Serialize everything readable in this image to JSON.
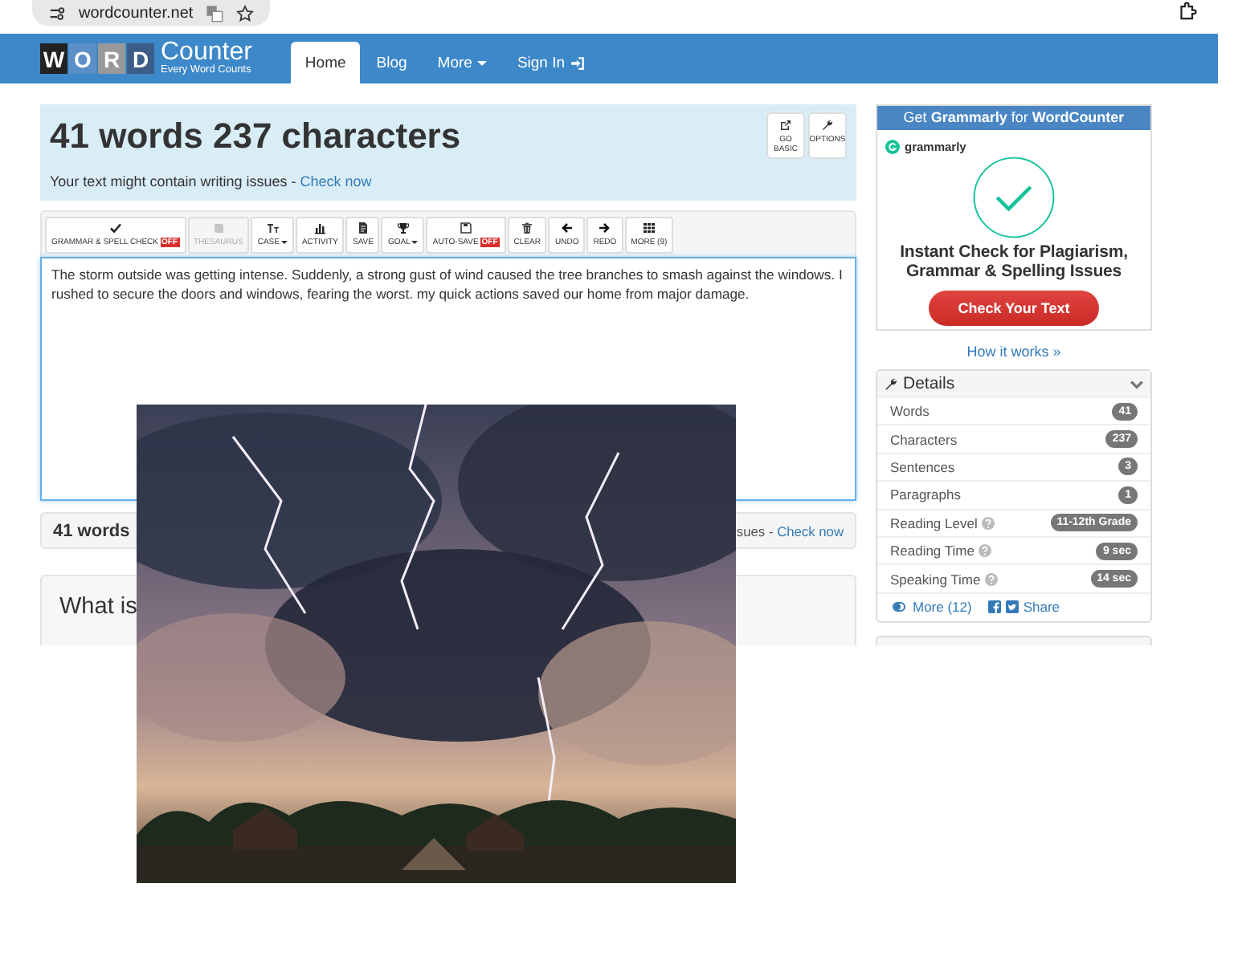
{
  "browser": {
    "url": "wordcounter.net"
  },
  "nav": {
    "logo_letters": [
      "W",
      "O",
      "R",
      "D"
    ],
    "logo_name": "Counter",
    "logo_tagline": "Every Word Counts",
    "items": [
      {
        "label": "Home",
        "selected": true,
        "kind": "link"
      },
      {
        "label": "Blog",
        "selected": false,
        "kind": "link"
      },
      {
        "label": "More",
        "selected": false,
        "kind": "dropdown"
      },
      {
        "label": "Sign In",
        "selected": false,
        "kind": "signin"
      }
    ]
  },
  "summary": {
    "title": "41 words 237 characters",
    "notice": "Your text might contain writing issues - ",
    "notice_link": "Check now",
    "buttons": [
      {
        "label": "GO BASIC"
      },
      {
        "label": "OPTIONS"
      }
    ]
  },
  "toolbar": [
    {
      "label": "GRAMMAR & SPELL CHECK",
      "badge": "OFF",
      "disabled": false,
      "dropdown": false
    },
    {
      "label": "THESAURUS",
      "disabled": true,
      "dropdown": false
    },
    {
      "label": "CASE",
      "disabled": false,
      "dropdown": true
    },
    {
      "label": "ACTIVITY",
      "disabled": false,
      "dropdown": false
    },
    {
      "label": "SAVE",
      "disabled": false,
      "dropdown": false
    },
    {
      "label": "GOAL",
      "disabled": false,
      "dropdown": true
    },
    {
      "label": "AUTO-SAVE",
      "badge": "OFF",
      "disabled": false,
      "dropdown": false
    },
    {
      "label": "CLEAR",
      "disabled": false,
      "dropdown": false
    },
    {
      "label": "UNDO",
      "disabled": false,
      "dropdown": false
    },
    {
      "label": "REDO",
      "disabled": false,
      "dropdown": false
    },
    {
      "label": "MORE (9)",
      "disabled": false,
      "dropdown": false
    }
  ],
  "editor": {
    "value": "The storm outside was getting intense. Suddenly, a strong gust of wind caused the tree branches to smash against the windows. I rushed to secure the doors and windows, fearing the worst. my quick actions saved our home from major damage."
  },
  "status_bar": {
    "left": "41 words",
    "right": "sues - ",
    "right_link": "Check now"
  },
  "info": {
    "heading": "What is"
  },
  "sidebar": {
    "ad": {
      "header": "Get **Grammarly** for **WordCounter**",
      "brand": "grammarly",
      "headline": "Instant Check for Plagiarism, Grammar & Spelling Issues",
      "button": "Check Your Text"
    },
    "how_link": "How it works »",
    "details": {
      "title": "Details",
      "expanded": true,
      "rows": [
        {
          "label": "Words",
          "value": "41",
          "help": false
        },
        {
          "label": "Characters",
          "value": "237",
          "help": false
        },
        {
          "label": "Sentences",
          "value": "3",
          "help": false
        },
        {
          "label": "Paragraphs",
          "value": "1",
          "help": false
        },
        {
          "label": "Reading Level",
          "value": "11-12th Grade",
          "help": true
        },
        {
          "label": "Reading Time",
          "value": "9 sec",
          "help": true
        },
        {
          "label": "Speaking Time",
          "value": "14 sec",
          "help": true
        }
      ],
      "more": "More (12)",
      "share": "Share"
    }
  }
}
